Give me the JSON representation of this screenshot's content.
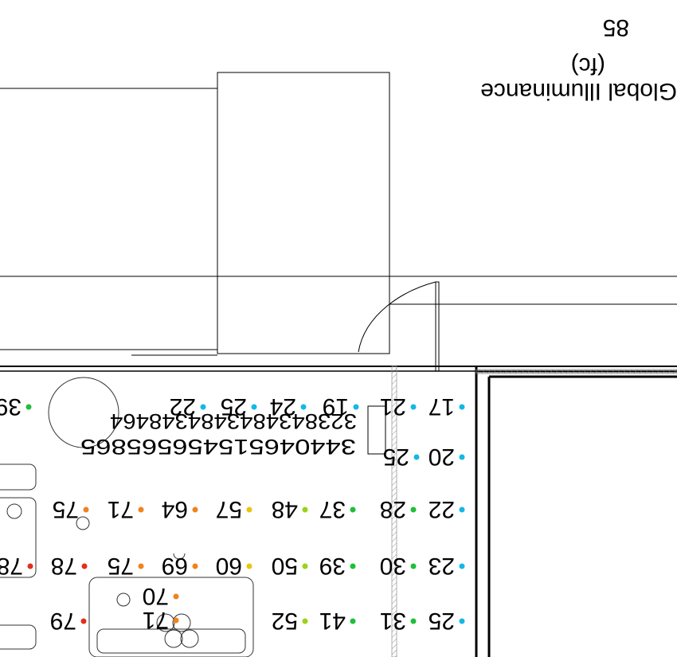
{
  "legend": {
    "title": "Global Illuminance",
    "unit": "(fc)",
    "partial_number": "85"
  },
  "colors": {
    "cyan": "#16b7e6",
    "green": "#1fbf3a",
    "lime": "#9bd21a",
    "yellow": "#e8c50e",
    "orange": "#f0831c",
    "red": "#e0301c"
  },
  "dense_rows": {
    "row1": "3238434843484348464",
    "row2": "344046515456565865"
  },
  "readings": [
    {
      "id": "r01",
      "value": "17",
      "color": "cyan"
    },
    {
      "id": "r02",
      "value": "21",
      "color": "cyan"
    },
    {
      "id": "r03",
      "value": "19",
      "color": "cyan"
    },
    {
      "id": "r04",
      "value": "24",
      "color": "cyan"
    },
    {
      "id": "r05",
      "value": "25",
      "color": "cyan"
    },
    {
      "id": "r06",
      "value": "22",
      "color": "cyan"
    },
    {
      "id": "r07",
      "value": "39",
      "color": "green"
    },
    {
      "id": "r08",
      "value": "20",
      "color": "cyan"
    },
    {
      "id": "r09",
      "value": "25",
      "color": "cyan"
    },
    {
      "id": "r10",
      "value": "22",
      "color": "cyan"
    },
    {
      "id": "r11",
      "value": "28",
      "color": "green"
    },
    {
      "id": "r12",
      "value": "37",
      "color": "green"
    },
    {
      "id": "r13",
      "value": "48",
      "color": "lime"
    },
    {
      "id": "r14",
      "value": "57",
      "color": "yellow"
    },
    {
      "id": "r15",
      "value": "64",
      "color": "orange"
    },
    {
      "id": "r16",
      "value": "71",
      "color": "orange"
    },
    {
      "id": "r17",
      "value": "75",
      "color": "orange"
    },
    {
      "id": "r18",
      "value": "23",
      "color": "cyan"
    },
    {
      "id": "r19",
      "value": "30",
      "color": "green"
    },
    {
      "id": "r20",
      "value": "39",
      "color": "green"
    },
    {
      "id": "r21",
      "value": "50",
      "color": "lime"
    },
    {
      "id": "r22",
      "value": "60",
      "color": "yellow"
    },
    {
      "id": "r23",
      "value": "69",
      "color": "orange"
    },
    {
      "id": "r24",
      "value": "75",
      "color": "orange"
    },
    {
      "id": "r25",
      "value": "78",
      "color": "red"
    },
    {
      "id": "r26",
      "value": "78",
      "color": "red"
    },
    {
      "id": "r27",
      "value": "70",
      "color": "orange"
    },
    {
      "id": "r28",
      "value": "71",
      "color": "orange"
    },
    {
      "id": "r29",
      "value": "25",
      "color": "cyan"
    },
    {
      "id": "r30",
      "value": "31",
      "color": "green"
    },
    {
      "id": "r31",
      "value": "41",
      "color": "green"
    },
    {
      "id": "r32",
      "value": "52",
      "color": "lime"
    },
    {
      "id": "r33",
      "value": "79",
      "color": "red"
    }
  ]
}
